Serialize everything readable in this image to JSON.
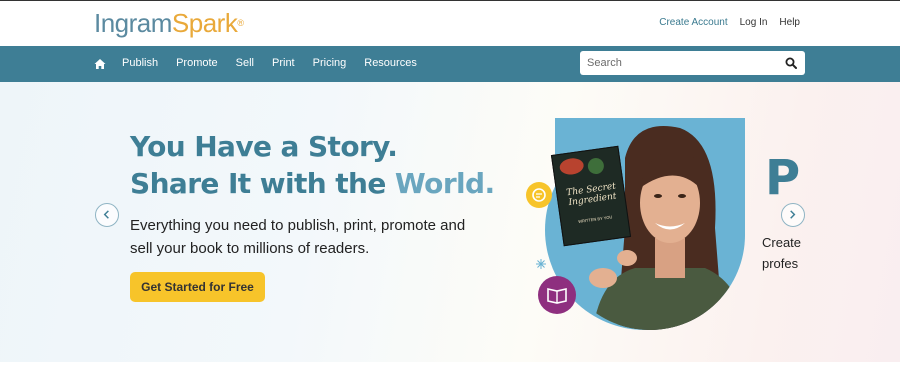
{
  "brand": {
    "part1": "Ingram",
    "part2": "Spark",
    "mark": "®"
  },
  "toplinks": {
    "create_account": "Create Account",
    "login": "Log In",
    "help": "Help"
  },
  "nav": {
    "items": [
      "Publish",
      "Promote",
      "Sell",
      "Print",
      "Pricing",
      "Resources"
    ]
  },
  "search": {
    "placeholder": "Search"
  },
  "hero": {
    "headline_line1": "You Have a Story.",
    "headline_line2_a": "Share It with the ",
    "headline_line2_b": "World.",
    "subtext": "Everything you need to publish, print, promote and sell your book to millions of readers.",
    "cta": "Get Started for Free",
    "book_title": "The Secret Ingredient",
    "book_author": "WRITTEN BY YOU",
    "next_slide_letter": "P",
    "next_slide_line1": "Create",
    "next_slide_line2": "profes"
  },
  "colors": {
    "primary": "#3e7e95",
    "accent": "#f7c42a",
    "light_blue": "#6aa6bf",
    "purple": "#8e2f7f"
  }
}
